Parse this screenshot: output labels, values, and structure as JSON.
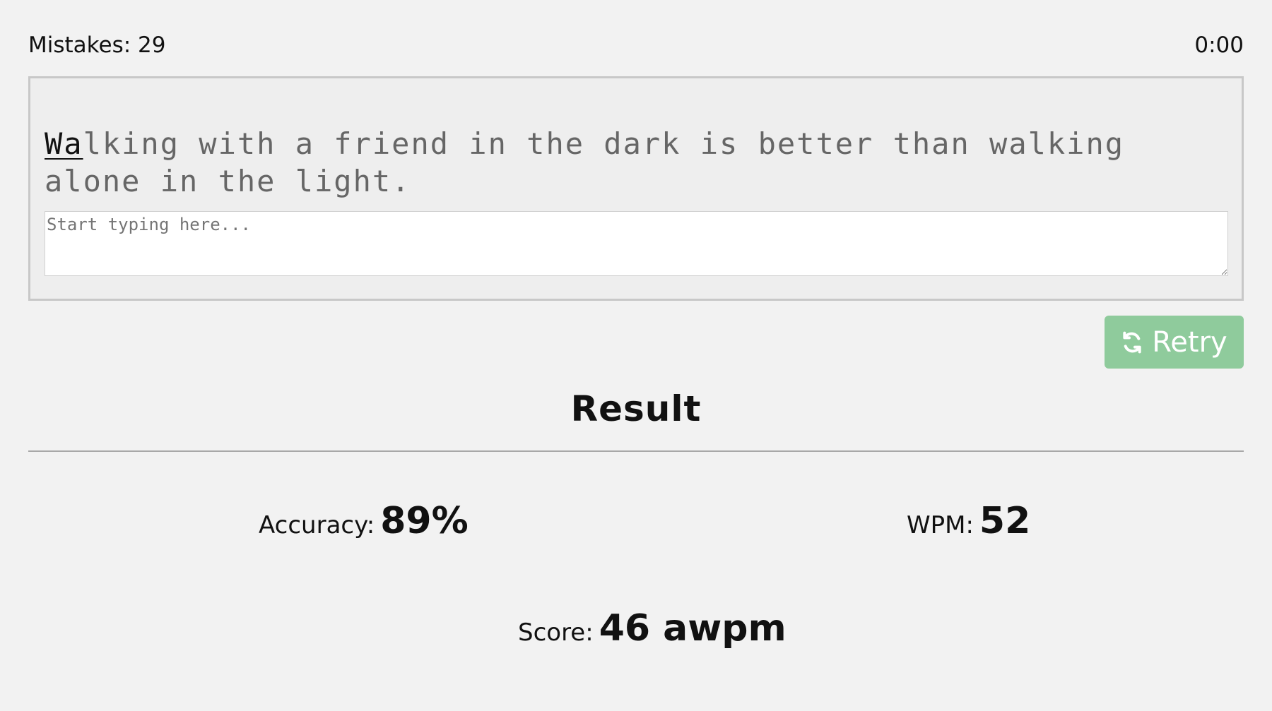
{
  "top": {
    "mistakes_label": "Mistakes:",
    "mistakes_value": "29",
    "timer": "0:00"
  },
  "typing": {
    "quote_typed": "Wa",
    "quote_remaining": "lking with a friend in the dark is better than walking alone in the light.",
    "input_value": "",
    "input_placeholder": "Start typing here..."
  },
  "actions": {
    "retry_label": "Retry",
    "retry_icon": "refresh-icon",
    "button_color": "#8fcb9c"
  },
  "result": {
    "title": "Result",
    "accuracy_label": "Accuracy:",
    "accuracy_value": "89%",
    "wpm_label": "WPM:",
    "wpm_value": "52",
    "score_label": "Score:",
    "score_value": "46 awpm"
  }
}
